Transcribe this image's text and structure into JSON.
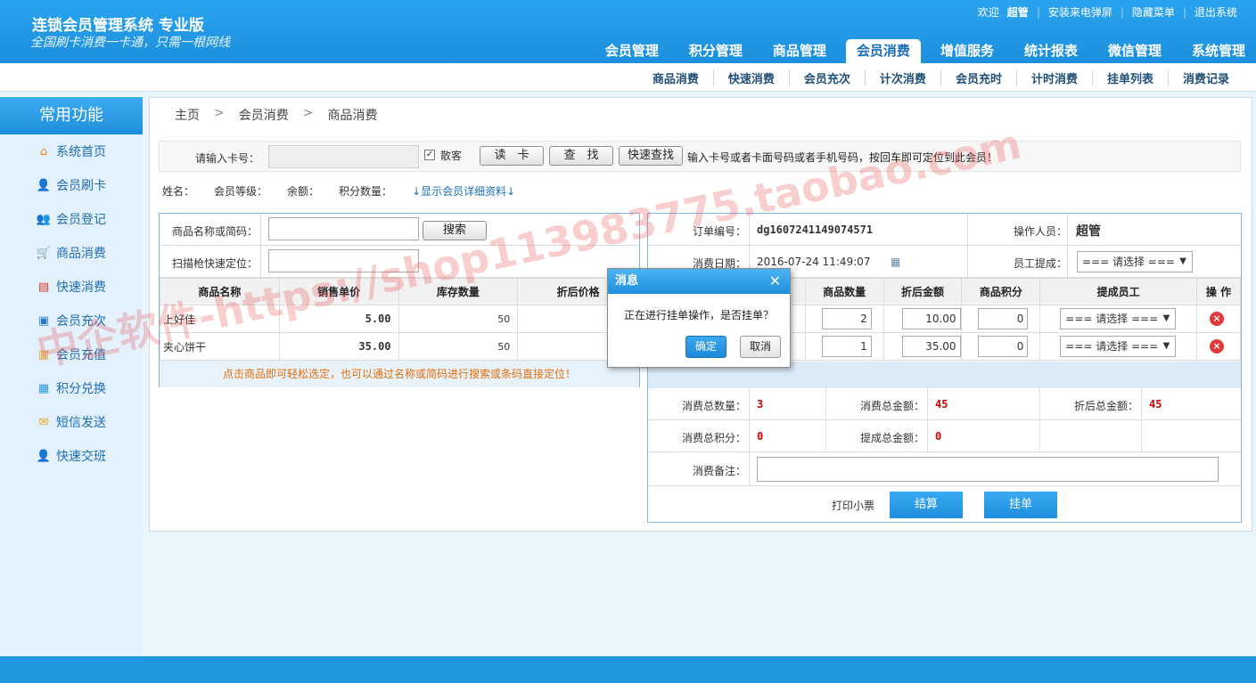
{
  "header": {
    "title": "连锁会员管理系统 专业版",
    "slogan": "全国刷卡消费一卡通，只需一根网线",
    "welcome": "欢迎",
    "user": "超管",
    "links": [
      "安装来电弹屏",
      "隐藏菜单",
      "退出系统"
    ],
    "nav": [
      "会员管理",
      "积分管理",
      "商品管理",
      "会员消费",
      "增值服务",
      "统计报表",
      "微信管理",
      "系统管理"
    ],
    "subnav": [
      "商品消费",
      "快速消费",
      "会员充次",
      "计次消费",
      "会员充时",
      "计时消费",
      "挂单列表",
      "消费记录"
    ]
  },
  "sidebar": {
    "title": "常用功能",
    "items": [
      {
        "label": "系统首页",
        "icon": "home-icon"
      },
      {
        "label": "会员刷卡",
        "icon": "member-card-icon"
      },
      {
        "label": "会员登记",
        "icon": "member-register-icon"
      },
      {
        "label": "商品消费",
        "icon": "cart-icon"
      },
      {
        "label": "快速消费",
        "icon": "chart-icon"
      },
      {
        "label": "会员充次",
        "icon": "recharge-count-icon"
      },
      {
        "label": "会员充值",
        "icon": "recharge-icon"
      },
      {
        "label": "积分兑换",
        "icon": "gift-icon"
      },
      {
        "label": "短信发送",
        "icon": "mail-icon"
      },
      {
        "label": "快速交班",
        "icon": "shift-icon"
      }
    ]
  },
  "breadcrumb": [
    "主页",
    "会员消费",
    "商品消费"
  ],
  "card": {
    "label": "请输入卡号：",
    "guest_label": "散客",
    "read_btn": "读　卡",
    "find_btn": "查　找",
    "quick_find_btn": "快速查找",
    "hint": "输入卡号或者卡面号码或者手机号码，按回车即可定位到此会员！"
  },
  "member_info": {
    "name": "姓名：",
    "level": "会员等级：",
    "balance": "余额：",
    "points": "积分数量：",
    "detail_link": "↓显示会员详细资料↓"
  },
  "product_search": {
    "name_label": "商品名称或简码：",
    "search_btn": "搜索",
    "scan_label": "扫描枪快速定位："
  },
  "product_table": {
    "headers": [
      "商品名称",
      "销售单价",
      "库存数量",
      "折后价格"
    ],
    "rows": [
      {
        "name": "上好佳",
        "price": "5.00",
        "stock": "50"
      },
      {
        "name": "夹心饼干",
        "price": "35.00",
        "stock": "50"
      }
    ],
    "tip": "点击商品即可轻松选定，也可以通过名称或简码进行搜索或条码直接定位！"
  },
  "order": {
    "no_label": "订单编号：",
    "no": "dg1607241149074571",
    "operator_label": "操作人员：",
    "operator": "超管",
    "date_label": "消费日期：",
    "date": "2016-07-24 11:49:07",
    "staff_label": "员工提成：",
    "select_placeholder": "=== 请选择 ===",
    "headers": [
      "商品数量",
      "折后金额",
      "商品积分",
      "提成员工",
      "操 作"
    ],
    "rows": [
      {
        "qty": "2",
        "amount": "10.00",
        "points": "0"
      },
      {
        "qty": "1",
        "amount": "35.00",
        "points": "0"
      }
    ],
    "total_qty_label": "消费总数量：",
    "total_qty": "3",
    "total_amount_label": "消费总金额：",
    "total_amount": "45",
    "discount_total_label": "折后总金额：",
    "discount_total": "45",
    "total_points_label": "消费总积分：",
    "total_points": "0",
    "commission_label": "提成总金额：",
    "commission": "0",
    "remark_label": "消费备注：",
    "print_label": "打印小票",
    "checkout_btn": "结算",
    "hold_btn": "挂单"
  },
  "dialog": {
    "title": "消息",
    "message": "正在进行挂单操作，是否挂单？",
    "ok": "确定",
    "cancel": "取消"
  },
  "watermark": "中企软件-https://shop113983775.taobao.com",
  "colors": {
    "accent": "#1f8ede",
    "header": "#2aa4ee",
    "red": "#d40000",
    "tip": "#e46f0a"
  }
}
